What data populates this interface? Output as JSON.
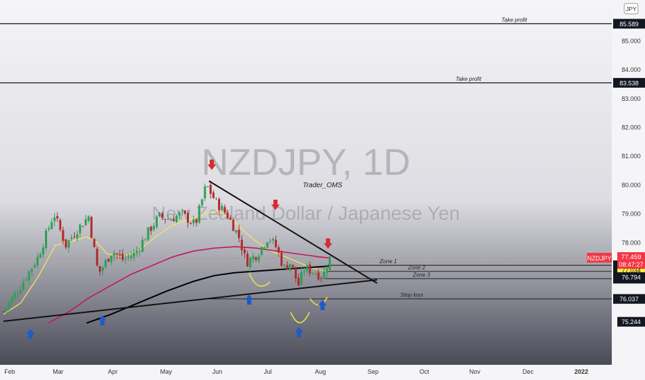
{
  "chart_data": {
    "type": "candlestick",
    "symbol": "NZDJPY",
    "interval": "1D",
    "watermark_title": "NZDJPY, 1D",
    "watermark_subtitle": "New Zealand Dollar / Japanese Yen",
    "author": "Trader_OMS",
    "currency_badge": "JPY",
    "x_ticks": [
      "Feb",
      "Mar",
      "Apr",
      "May",
      "Jun",
      "Jul",
      "Aug",
      "Sep",
      "Oct",
      "Nov",
      "Dec",
      "2022"
    ],
    "y_ticks": [
      "85.000",
      "84.000",
      "83.000",
      "82.000",
      "81.000",
      "80.000",
      "79.000",
      "78.000"
    ],
    "y_top_partial": "86",
    "ylim": [
      75.2,
      86.4
    ],
    "last_price": {
      "symbol": "NZDJPY",
      "value": "77.459",
      "countdown": "08:47:27",
      "color": "#f23645"
    },
    "levels": [
      {
        "name": "Take profit",
        "value": 85.589,
        "label": "85.589"
      },
      {
        "name": "Take profit",
        "value": 83.538,
        "label": "83.538"
      },
      {
        "name": "Zone 1",
        "value": 77.204,
        "label": "77.204"
      },
      {
        "name": "Zone 2",
        "value": 76.992,
        "label": "76.992"
      },
      {
        "name": "Zone 3",
        "value": 76.741,
        "label": "76.741"
      },
      {
        "name": "Stop loss",
        "value": 76.037,
        "label": "76.037"
      }
    ],
    "axis_tags": [
      {
        "label": "77.325",
        "value": 77.325,
        "bg": "#ad1457",
        "fg": "#ffffff"
      },
      {
        "label": "77.034",
        "value": 77.034,
        "bg": "#ffeb3b",
        "fg": "#131722"
      },
      {
        "label": "76.794",
        "value": 76.794,
        "bg": "#131722",
        "fg": "#ffffff"
      },
      {
        "label": "75.244",
        "value": 75.244,
        "bg": "#131722",
        "fg": "#ffffff"
      }
    ],
    "ma_colors": {
      "fast": "#f3e55b",
      "mid": "#c2185b",
      "slow": "#000000"
    },
    "candle_colors": {
      "up": "#2e9e55",
      "down": "#b02a2a"
    },
    "arrow_colors": {
      "up": "#1e5bc6",
      "down": "#d32f2f"
    }
  }
}
